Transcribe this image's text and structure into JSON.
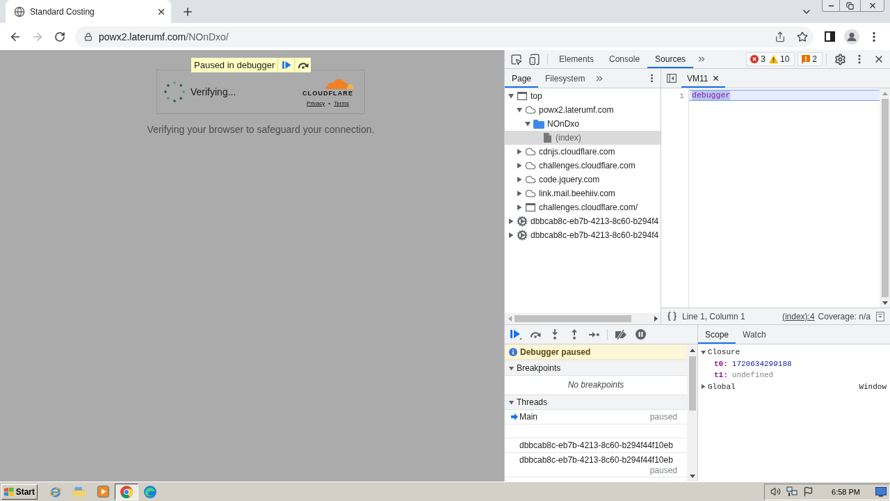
{
  "browser": {
    "tabs": [
      {
        "title": "Standard Costing",
        "selected": true
      }
    ],
    "address": {
      "host": "powx2.laterumf.com",
      "path": "/NOnDxo/"
    }
  },
  "page": {
    "debugger_overlay": {
      "label": "Paused in debugger"
    },
    "challenge": {
      "status": "Verifying...",
      "brand": "CLOUDFLARE",
      "links": [
        "Privacy",
        "Terms"
      ],
      "link_separator": "•"
    },
    "message": "Verifying your browser to safeguard your connection."
  },
  "devtools": {
    "tabs": [
      {
        "label": "Elements",
        "selected": false
      },
      {
        "label": "Console",
        "selected": false
      },
      {
        "label": "Sources",
        "selected": true
      }
    ],
    "counters": {
      "errors": "3",
      "warnings": "10",
      "issues": "2"
    },
    "navigator": {
      "tabs": [
        {
          "label": "Page",
          "selected": true
        },
        {
          "label": "Filesystem",
          "selected": false
        }
      ],
      "tree": [
        {
          "label": "top",
          "kind": "frame",
          "expanded": true,
          "selected": false,
          "children": [
            {
              "label": "powx2.laterumf.com",
              "kind": "domain",
              "expanded": true,
              "selected": false,
              "children": [
                {
                  "label": "NOnDxo",
                  "kind": "folder",
                  "expanded": true,
                  "selected": false,
                  "children": [
                    {
                      "label": "(index)",
                      "kind": "file",
                      "selected": true
                    }
                  ]
                }
              ]
            },
            {
              "label": "cdnjs.cloudflare.com",
              "kind": "domain",
              "expanded": false,
              "selected": false
            },
            {
              "label": "challenges.cloudflare.com",
              "kind": "domain",
              "expanded": false,
              "selected": false
            },
            {
              "label": "code.jquery.com",
              "kind": "domain",
              "expanded": false,
              "selected": false
            },
            {
              "label": "link.mail.beehiiv.com",
              "kind": "domain",
              "expanded": false,
              "selected": false
            },
            {
              "label": "challenges.cloudflare.com/",
              "kind": "frame",
              "expanded": false,
              "selected": false
            }
          ]
        },
        {
          "label": "dbbcab8c-eb7b-4213-8c60-b294f4",
          "kind": "worker",
          "expanded": false,
          "selected": false
        },
        {
          "label": "dbbcab8c-eb7b-4213-8c60-b294f4",
          "kind": "worker",
          "expanded": false,
          "selected": false
        }
      ]
    },
    "editor": {
      "tabs": [
        {
          "label": "VM11",
          "selected": true
        }
      ],
      "lines": [
        {
          "number": "1",
          "code": "debugger",
          "highlighted": true
        }
      ],
      "status": {
        "position": "Line 1, Column 1",
        "source_link": "(index):4",
        "coverage": "Coverage: n/a"
      }
    },
    "debugger": {
      "paused_message": "Debugger paused",
      "breakpoints": {
        "title": "Breakpoints",
        "expanded": true,
        "empty_text": "No breakpoints"
      },
      "threads": {
        "title": "Threads",
        "expanded": true,
        "items": [
          {
            "name": "Main",
            "status": "paused",
            "selected": true
          },
          {
            "name": "dbbcab8c-eb7b-4213-8c60-b294f44f10eb",
            "selected": false
          },
          {
            "name": "dbbcab8c-eb7b-4213-8c60-b294f44f10eb",
            "status": "paused",
            "selected": false
          }
        ]
      }
    },
    "sidebar": {
      "tabs": [
        {
          "label": "Scope",
          "selected": true
        },
        {
          "label": "Watch",
          "selected": false
        }
      ],
      "scope": [
        {
          "label": "Closure",
          "expanded": true,
          "children": [
            {
              "name": "t0:",
              "value": "1720634299188",
              "kind": "number"
            },
            {
              "name": "t1:",
              "value": "undefined",
              "kind": "undefined"
            }
          ]
        },
        {
          "label": "Global",
          "expanded": false,
          "value": "Window"
        }
      ]
    }
  },
  "taskbar": {
    "start": "Start",
    "apps": [
      {
        "kind": "internet-explorer",
        "selected": false
      },
      {
        "kind": "file-explorer",
        "selected": false
      },
      {
        "kind": "media-player",
        "selected": false
      },
      {
        "kind": "chrome",
        "selected": true
      },
      {
        "kind": "edge",
        "selected": false
      }
    ],
    "clock": "6:58 PM"
  }
}
